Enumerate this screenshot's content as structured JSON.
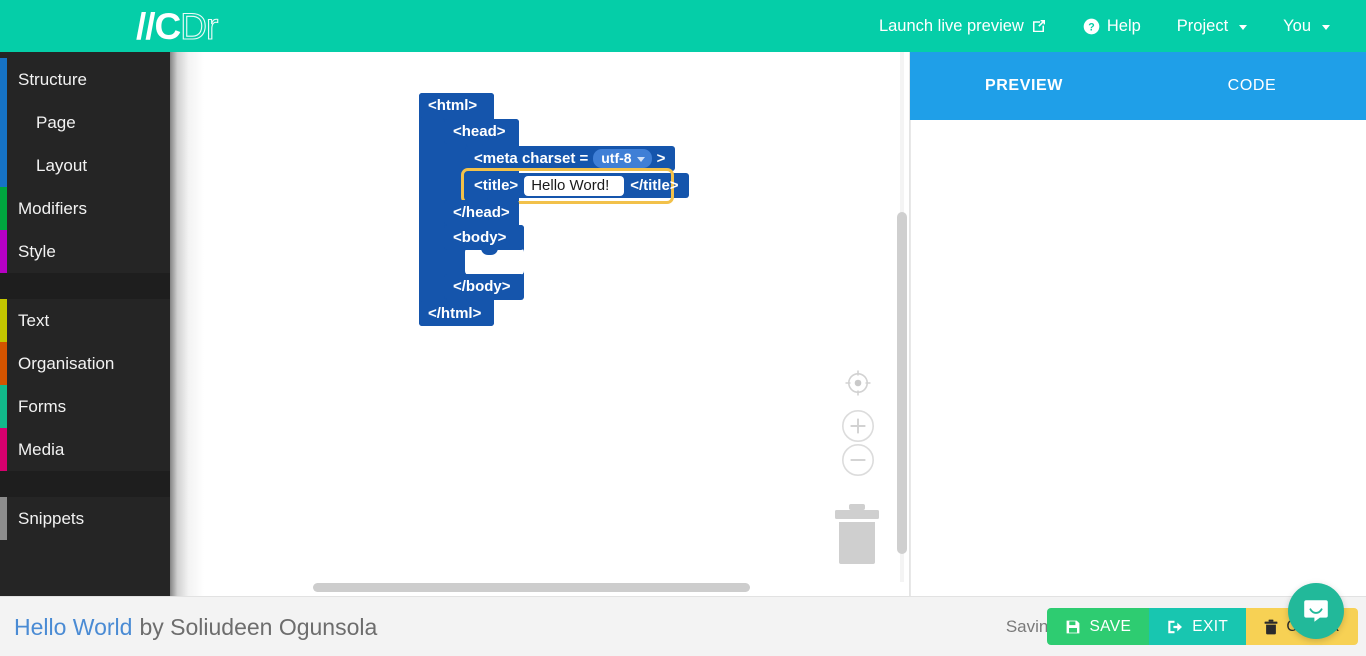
{
  "brand": {
    "logo_primary": "//C",
    "logo_secondary": "Dr",
    "header_color": "#05CEA8"
  },
  "topnav": {
    "items": [
      {
        "label": "Launch live preview",
        "icon": "external-link-icon"
      },
      {
        "label": "Help",
        "icon": "question-circle-icon"
      },
      {
        "label": "Project",
        "icon": "chevron-down-icon"
      },
      {
        "label": "You",
        "icon": "chevron-down-icon"
      }
    ]
  },
  "sidebar": {
    "items": [
      {
        "label": "Structure",
        "color": "#1673c6",
        "sub": false
      },
      {
        "label": "Page",
        "color": "#1673c6",
        "sub": true
      },
      {
        "label": "Layout",
        "color": "#1673c6",
        "sub": true
      },
      {
        "label": "Modifiers",
        "color": "#00a63f",
        "sub": false
      },
      {
        "label": "Style",
        "color": "#b700c4",
        "sub": false
      }
    ],
    "items2": [
      {
        "label": "Text",
        "color": "#c3c600",
        "sub": false
      },
      {
        "label": "Organisation",
        "color": "#d35400",
        "sub": false
      },
      {
        "label": "Forms",
        "color": "#12b98a",
        "sub": false
      },
      {
        "label": "Media",
        "color": "#d6006e",
        "sub": false
      }
    ],
    "items3": [
      {
        "label": "Snippets",
        "color": "#8c8c8c",
        "sub": false
      }
    ]
  },
  "canvas": {
    "blocks": {
      "html_open": "<html>",
      "head_open": "<head>",
      "meta_label": "<meta charset =",
      "meta_value": "utf-8",
      "meta_close": ">",
      "title_open": "<title>",
      "title_value": "Hello Word!",
      "title_close": "</title>",
      "head_close": "</head>",
      "body_open": "<body>",
      "body_close": "</body>",
      "html_close": "</html>"
    },
    "tools": [
      {
        "name": "center-canvas-icon"
      },
      {
        "name": "zoom-in-icon"
      },
      {
        "name": "zoom-out-icon"
      },
      {
        "name": "trash-icon"
      }
    ],
    "block_color": "#1555AC",
    "highlight_color": "#F2C14A"
  },
  "right_panel": {
    "tabs": [
      {
        "label": "PREVIEW",
        "active": true
      },
      {
        "label": "CODE",
        "active": false
      }
    ],
    "tab_color": "#1F9FE8"
  },
  "bottom": {
    "project_name": "Hello World",
    "project_author": "by Soliudeen Ogunsola",
    "status": "Saving...",
    "buttons": [
      {
        "label": "SAVE",
        "icon": "floppy-disk-icon",
        "color": "#2ECC71"
      },
      {
        "label": "EXIT",
        "icon": "sign-out-icon",
        "color": "#18C6B0"
      },
      {
        "label": "CLEAR",
        "icon": "trash-icon",
        "color": "#F7D154"
      }
    ]
  },
  "chat": {
    "icon": "chat-bubble-icon",
    "color": "#22B99A"
  }
}
